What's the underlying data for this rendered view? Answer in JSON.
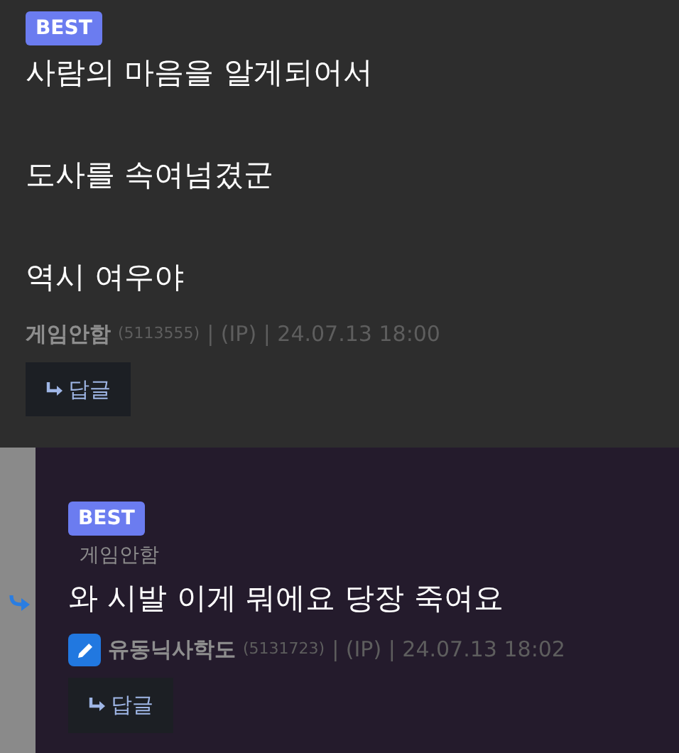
{
  "comments": [
    {
      "kind": "comment",
      "badge": "BEST",
      "lines": [
        "사람의 마음을 알게되어서",
        "도사를 속여넘겼군",
        "역시 여우야"
      ],
      "author": "게임안함",
      "author_icon": false,
      "user_id": "(5113555)",
      "meta": "| (IP) | 24.07.13 18:00",
      "reply_button": "답글"
    },
    {
      "kind": "reply",
      "badge": "BEST",
      "reply_to": "게임안함",
      "lines": [
        "와 시발 이게 뭐에요 당장 죽여요"
      ],
      "author": "유동닉사학도",
      "author_icon": true,
      "user_id": "(5131723)",
      "meta": "| (IP) | 24.07.13 18:02",
      "reply_button": "답글"
    }
  ]
}
